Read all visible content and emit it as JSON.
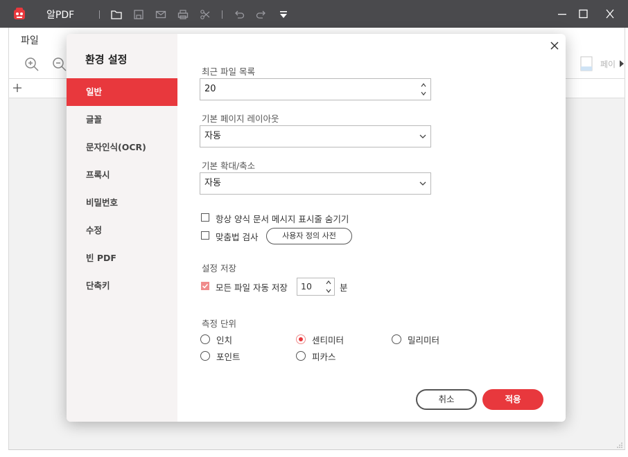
{
  "app": {
    "name": "알PDF",
    "menu_file": "파일",
    "page_label": "페이"
  },
  "colors": {
    "accent": "#e8383d",
    "titlebar": "#4a4a4d",
    "sidebar": "#f6f3f3"
  },
  "dialog": {
    "title": "환경 설정",
    "sidebar": [
      {
        "label": "일반",
        "active": true
      },
      {
        "label": "글꼴"
      },
      {
        "label": "문자인식(OCR)"
      },
      {
        "label": "프록시"
      },
      {
        "label": "비밀번호"
      },
      {
        "label": "수정"
      },
      {
        "label": "빈 PDF"
      },
      {
        "label": "단축키"
      }
    ],
    "recent_files": {
      "label": "최근 파일 목록",
      "value": "20"
    },
    "page_layout": {
      "label": "기본 페이지 레이아웃",
      "value": "자동"
    },
    "zoom": {
      "label": "기본 확대/축소",
      "value": "자동"
    },
    "always_hide_form_msg": {
      "label": "항상 양식 문서 메시지 표시줄 숨기기",
      "checked": false
    },
    "spell_check": {
      "label": "맞춤법 검사",
      "checked": false,
      "dictionary_button": "사용자 정의 사전"
    },
    "save_settings": {
      "label": "설정 저장",
      "autosave_label": "모든 파일 자동 저장",
      "autosave_checked": true,
      "interval": "10",
      "unit": "분"
    },
    "measurement": {
      "label": "측정 단위",
      "options": [
        {
          "label": "인치",
          "selected": false
        },
        {
          "label": "센티미터",
          "selected": true
        },
        {
          "label": "밀리미터",
          "selected": false
        },
        {
          "label": "포인트",
          "selected": false
        },
        {
          "label": "피카스",
          "selected": false
        }
      ]
    },
    "cancel": "취소",
    "apply": "적용"
  }
}
